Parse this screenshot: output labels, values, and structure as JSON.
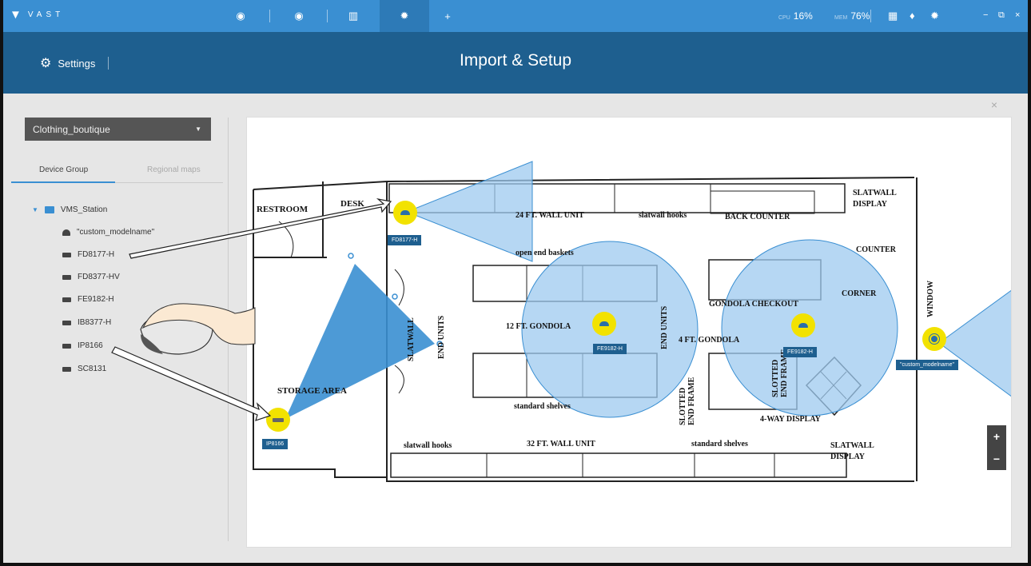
{
  "topbar": {
    "brand": "VAST",
    "tabs": [
      {
        "icon": "eye-icon",
        "glyph": "◉"
      },
      {
        "icon": "eye-icon",
        "glyph": "◉"
      },
      {
        "icon": "map-icon",
        "glyph": "▥"
      },
      {
        "icon": "gear-icon",
        "glyph": "✹"
      },
      {
        "icon": "plus-icon",
        "glyph": "+"
      }
    ],
    "cpu_label": "CPU",
    "cpu_value": "16%",
    "mem_label": "MEM",
    "mem_value": "76%"
  },
  "header": {
    "settings_label": "Settings",
    "title": "Import & Setup"
  },
  "left_panel": {
    "selected_map": "Clothing_boutique",
    "tabs": [
      "Device Group",
      "Regional maps"
    ],
    "tree_root": "VMS_Station",
    "devices": [
      "\"custom_modelname\"",
      "FD8177-H",
      "FD8377-HV",
      "FE9182-H",
      "IB8377-H",
      "IP8166",
      "SC8131"
    ]
  },
  "map": {
    "labels": {
      "restroom": "RESTROOM",
      "desk": "DESK",
      "wall_unit_24": "24 FT. WALL UNIT",
      "slatwall_hooks_top": "slatwall hooks",
      "back_counter": "BACK COUNTER",
      "slatwall_display_top": "SLATWALL\nDISPLAY",
      "counter": "COUNTER",
      "open_end_baskets": "open end baskets",
      "gondola_12": "12 FT. GONDOLA",
      "end_units_left": "END UNITS",
      "end_units_right": "END UNITS",
      "slatwall_vert": "SLATWALL",
      "gondola_4": "4 FT. GONDOLA",
      "gondola_checkout": "GONDOLA CHECKOUT",
      "corner": "CORNER",
      "window": "WINDOW",
      "storage_area": "STORAGE AREA",
      "standard_shelves_mid": "standard shelves",
      "slotted_end_frame_1": "SLOTTED\nEND FRAME",
      "slotted_end_frame_2": "SLOTTED\nEND FRAME",
      "four_way_display": "4-WAY DISPLAY",
      "slatwall_hooks_bottom": "slatwall hooks",
      "wall_unit_32": "32 FT. WALL UNIT",
      "standard_shelves_bottom": "standard shelves",
      "slatwall_display_bottom": "SLATWALL\nDISPLAY"
    },
    "cameras": [
      {
        "name": "FD8177-H",
        "type": "dome"
      },
      {
        "name": "FE9182-H",
        "type": "fisheye"
      },
      {
        "name": "FE9182-H",
        "type": "fisheye"
      },
      {
        "name": "\"custom_modelname\"",
        "type": "ring"
      },
      {
        "name": "IP8166",
        "type": "bullet"
      }
    ],
    "zoom_in": "+",
    "zoom_out": "−"
  },
  "colors": {
    "topbar": "#3a8fd2",
    "header": "#1e5f8f",
    "camera": "#f2e200",
    "fov": "#9ec9ef"
  }
}
